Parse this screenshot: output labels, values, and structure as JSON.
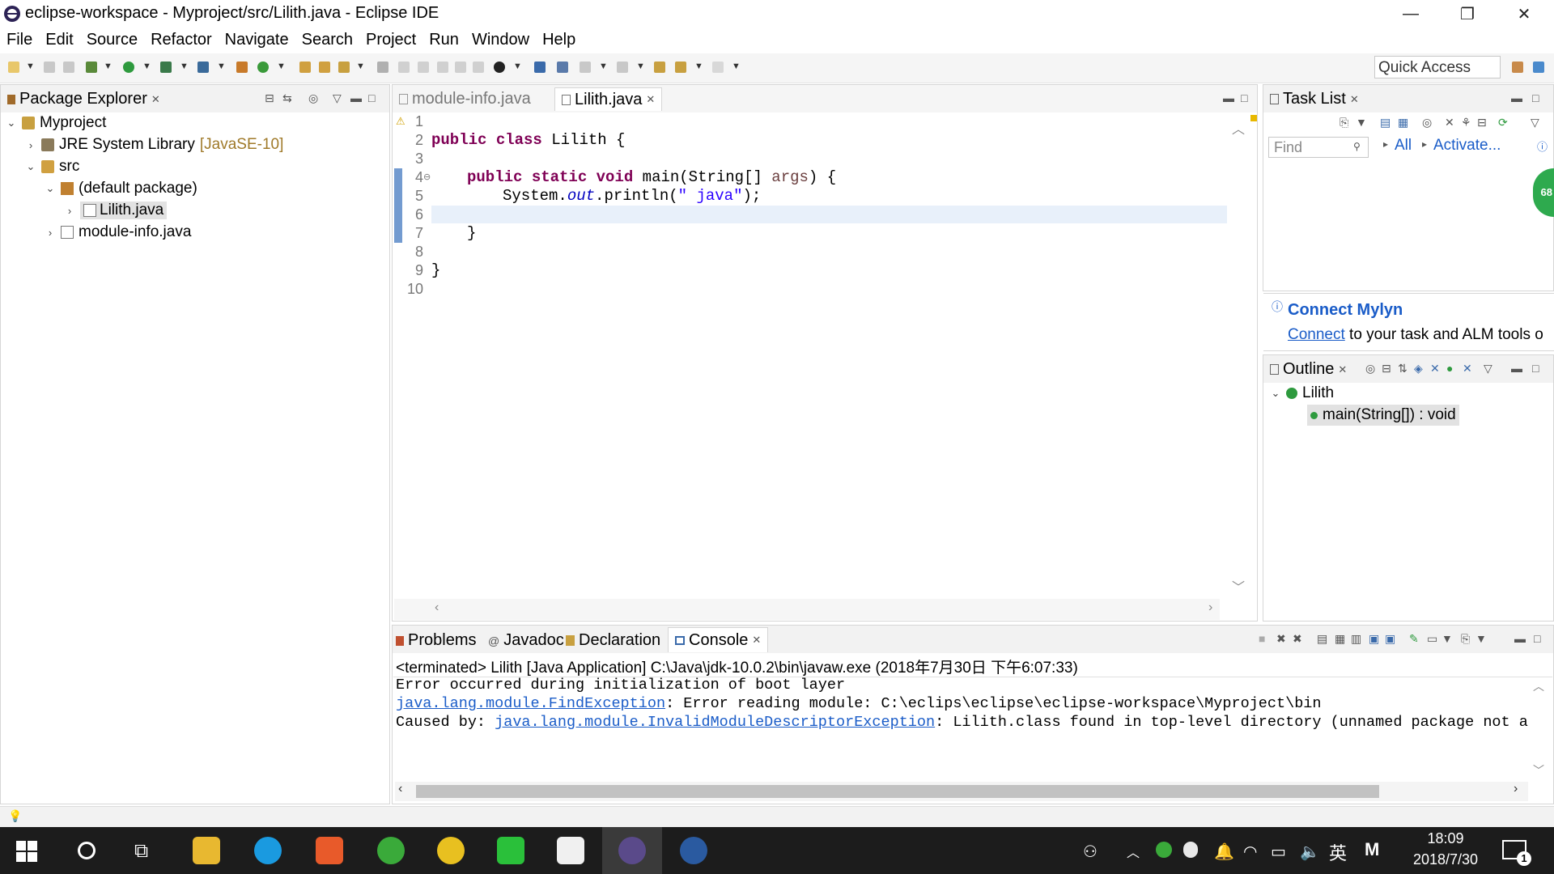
{
  "window": {
    "title": "eclipse-workspace - Myproject/src/Lilith.java - Eclipse IDE",
    "minimize": "—",
    "maximize": "❐",
    "close": "✕"
  },
  "menu": [
    "File",
    "Edit",
    "Source",
    "Refactor",
    "Navigate",
    "Search",
    "Project",
    "Run",
    "Window",
    "Help"
  ],
  "toolbar": {
    "quick_access": "Quick Access"
  },
  "package_explorer": {
    "title": "Package Explorer",
    "tree": {
      "project": "Myproject",
      "jre": "JRE System Library",
      "jre_version": "[JavaSE-10]",
      "src": "src",
      "default_package": "(default package)",
      "file_lilith": "Lilith.java",
      "file_module_info": "module-info.java"
    }
  },
  "editor": {
    "tabs": {
      "module_info": "module-info.java",
      "lilith": "Lilith.java"
    },
    "line_numbers": [
      "1",
      "2",
      "3",
      "4",
      "5",
      "6",
      "7",
      "8",
      "9",
      "10"
    ],
    "fold_marker": "⊖",
    "code": {
      "kw_public": "public",
      "kw_class": "class",
      "class_name": " Lilith {",
      "kw_static": "static",
      "kw_void": "void",
      "method_sig": " main(String[] ",
      "param": "args",
      "method_end": ") {",
      "sys": "System.",
      "out": "out",
      "println": ".println(",
      "string": "\" java\"",
      "stmt_end": ");",
      "brace": "}"
    }
  },
  "task_list": {
    "title": "Task List",
    "find_placeholder": "Find",
    "all": "All",
    "activate": "Activate...",
    "badge": "68"
  },
  "mylyn": {
    "title": "Connect Mylyn",
    "link": "Connect",
    "text": " to your task and ALM tools o"
  },
  "outline": {
    "title": "Outline",
    "class": "Lilith",
    "method": "main(String[]) : void"
  },
  "bottom_tabs": {
    "problems": "Problems",
    "javadoc": "Javadoc",
    "declaration": "Declaration",
    "console": "Console"
  },
  "console": {
    "header": "<terminated> Lilith [Java Application] C:\\Java\\jdk-10.0.2\\bin\\javaw.exe (2018年7月30日 下午6:07:33)",
    "line1": "Error occurred during initialization of boot layer",
    "line2_link": "java.lang.module.FindException",
    "line2_text": ": Error reading module: C:\\eclips\\eclipse\\eclipse-workspace\\Myproject\\bin",
    "line3_prefix": "Caused by: ",
    "line3_link": "java.lang.module.InvalidModuleDescriptorException",
    "line3_text": ": Lilith.class found in top-level directory (unnamed package not al"
  },
  "taskbar": {
    "time": "18:09",
    "date": "2018/7/30",
    "ime": "英",
    "ime_mode": "M",
    "notifications": "1"
  },
  "colors": {
    "keyword": "#7f0055",
    "string": "#2a00ff",
    "field": "#0000c0",
    "link": "#1a5cc8",
    "taskbar": "#1c1c1c"
  }
}
